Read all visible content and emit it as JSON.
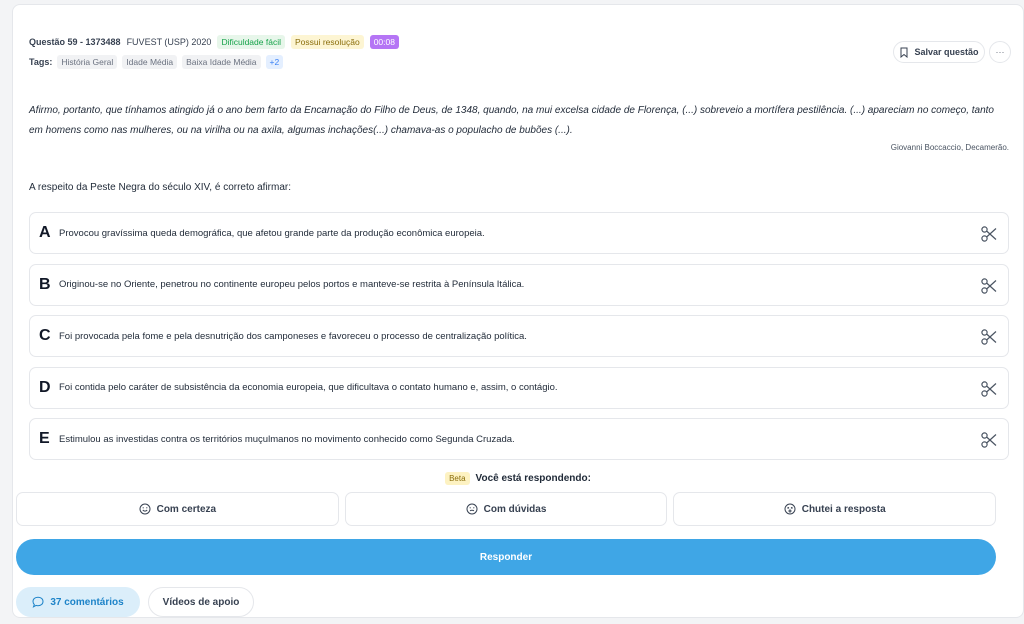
{
  "question": {
    "id_label": "Questão 59 - 1373488",
    "exam": "FUVEST (USP) 2020",
    "difficulty": "Dificuldade fácil",
    "solution_badge": "Possui resolução",
    "timer": "00:08",
    "tags_label": "Tags:",
    "tags": [
      "História Geral",
      "Idade Média",
      "Baixa Idade Média"
    ],
    "more_tags": "+2",
    "save_label": "Salvar questão",
    "more_label": "···",
    "passage": "Afirmo, portanto, que tínhamos atingido já o ano bem farto da Encarnação do Filho de Deus, de 1348, quando, na mui excelsa cidade de Florença, (...) sobreveio a mortífera pestilência. (...) apareciam no começo, tanto em homens como nas mulheres, ou na virilha ou na axila, algumas inchações(...) chamava-as o populacho de bubões (...).",
    "source": "Giovanni Boccaccio, Decamerão.",
    "statement": "A respeito da Peste Negra do século XIV, é correto afirmar:",
    "options": [
      {
        "letter": "A",
        "text": "Provocou gravíssima queda demográfica, que afetou grande parte da produção econômica europeia."
      },
      {
        "letter": "B",
        "text": "Originou-se no Oriente, penetrou no continente europeu pelos portos e manteve-se restrita à Península Itálica."
      },
      {
        "letter": "C",
        "text": "Foi provocada pela fome e pela desnutrição dos camponeses e favoreceu o processo de centralização política."
      },
      {
        "letter": "D",
        "text": "Foi contida pelo caráter de subsistência da economia europeia, que dificultava o contato humano e, assim, o contágio."
      },
      {
        "letter": "E",
        "text": "Estimulou as investidas contra os territórios muçulmanos no movimento conhecido como Segunda Cruzada."
      }
    ]
  },
  "response": {
    "beta": "Beta",
    "title": "Você está respondendo:",
    "confidence": [
      "Com certeza",
      "Com dúvidas",
      "Chutei a resposta"
    ],
    "answer_label": "Responder"
  },
  "footer": {
    "comments_label": "37 comentários",
    "videos_label": "Vídeos de apoio"
  },
  "colors": {
    "accent": "#3fa6e6",
    "timer": "#b575f5"
  },
  "icons": {
    "save": "bookmark-icon",
    "option_action": "scissors-icon",
    "confidence": [
      "smile-icon",
      "neutral-face-icon",
      "dizzy-face-icon"
    ],
    "comments": "chat-bubble-icon"
  }
}
